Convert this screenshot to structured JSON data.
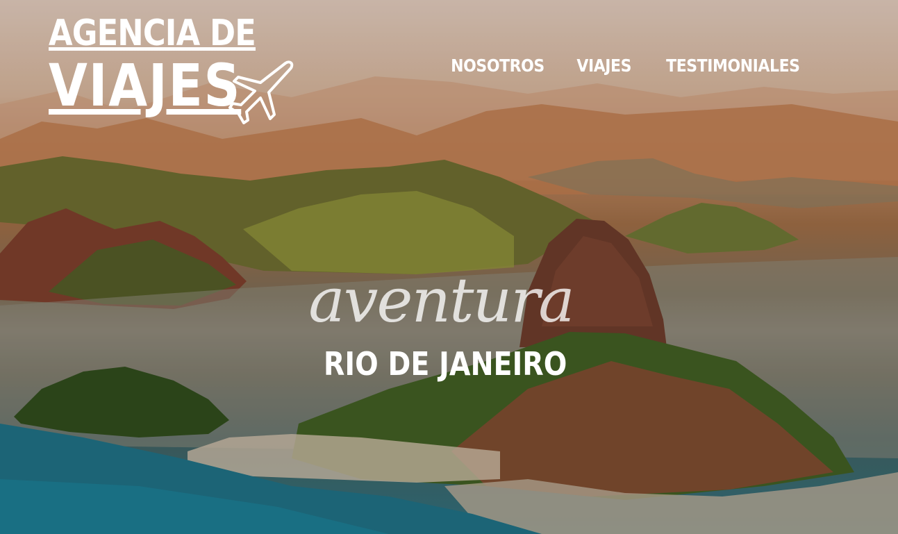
{
  "brand": {
    "line1": "AGENCIA DE",
    "line2": "VIAJES",
    "icon": "airplane-icon"
  },
  "nav": {
    "items": [
      {
        "label": "NOSOTROS"
      },
      {
        "label": "VIAJES"
      },
      {
        "label": "TESTIMONIALES"
      }
    ]
  },
  "hero": {
    "tagline": "aventura",
    "destination": "RIO DE JANEIRO",
    "text_color": "#ffffff"
  }
}
